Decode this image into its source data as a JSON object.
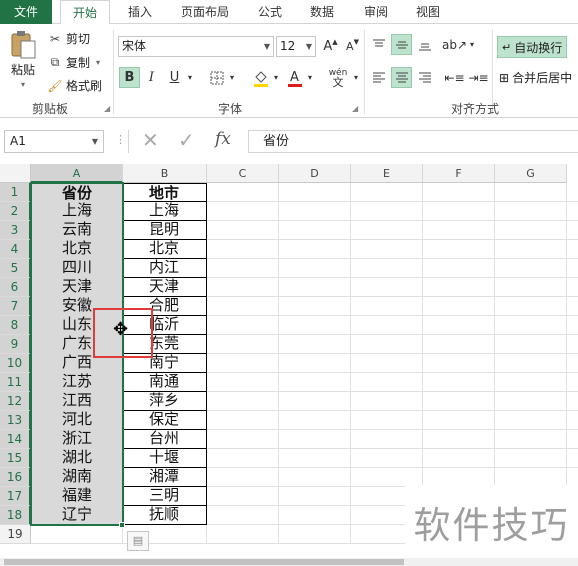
{
  "tabs": [
    {
      "label": "文件",
      "active": false,
      "file": true
    },
    {
      "label": "开始",
      "active": true,
      "file": false
    },
    {
      "label": "插入",
      "active": false,
      "file": false
    },
    {
      "label": "页面布局",
      "active": false,
      "file": false
    },
    {
      "label": "公式",
      "active": false,
      "file": false
    },
    {
      "label": "数据",
      "active": false,
      "file": false
    },
    {
      "label": "审阅",
      "active": false,
      "file": false
    },
    {
      "label": "视图",
      "active": false,
      "file": false
    }
  ],
  "clipboard": {
    "paste": "粘贴",
    "cut": "剪切",
    "copy": "复制",
    "format_painter": "格式刷",
    "group_label": "剪贴板"
  },
  "font": {
    "family": "宋体",
    "size": "12",
    "group_label": "字体",
    "bold": "B",
    "italic": "I",
    "underline": "U",
    "grow": "A",
    "shrink": "A",
    "phonetic": "wén"
  },
  "alignment": {
    "wrap_text": "自动换行",
    "merge_center": "合并后居中",
    "group_label": "对齐方式"
  },
  "formula_bar": {
    "name_box": "A1",
    "fx": "fx",
    "content": "省份"
  },
  "columns": [
    "A",
    "B",
    "C",
    "D",
    "E",
    "F",
    "G"
  ],
  "rows": [
    "1",
    "2",
    "3",
    "4",
    "5",
    "6",
    "7",
    "8",
    "9",
    "10",
    "11",
    "12",
    "13",
    "14",
    "15",
    "16",
    "17",
    "18",
    "19"
  ],
  "table": [
    [
      "省份",
      "地市"
    ],
    [
      "上海",
      "上海"
    ],
    [
      "云南",
      "昆明"
    ],
    [
      "北京",
      "北京"
    ],
    [
      "四川",
      "内江"
    ],
    [
      "天津",
      "天津"
    ],
    [
      "安徽",
      "合肥"
    ],
    [
      "山东",
      "临沂"
    ],
    [
      "广东",
      "东莞"
    ],
    [
      "广西",
      "南宁"
    ],
    [
      "江苏",
      "南通"
    ],
    [
      "江西",
      "萍乡"
    ],
    [
      "河北",
      "保定"
    ],
    [
      "浙江",
      "台州"
    ],
    [
      "湖北",
      "十堰"
    ],
    [
      "湖南",
      "湘潭"
    ],
    [
      "福建",
      "三明"
    ],
    [
      "辽宁",
      "抚顺"
    ]
  ],
  "watermark": "软件技巧",
  "colors": {
    "accent": "#217346",
    "highlight": "#bde2cd",
    "selected_fill": "#d9d9d9",
    "annotation": "#e03a3a"
  }
}
